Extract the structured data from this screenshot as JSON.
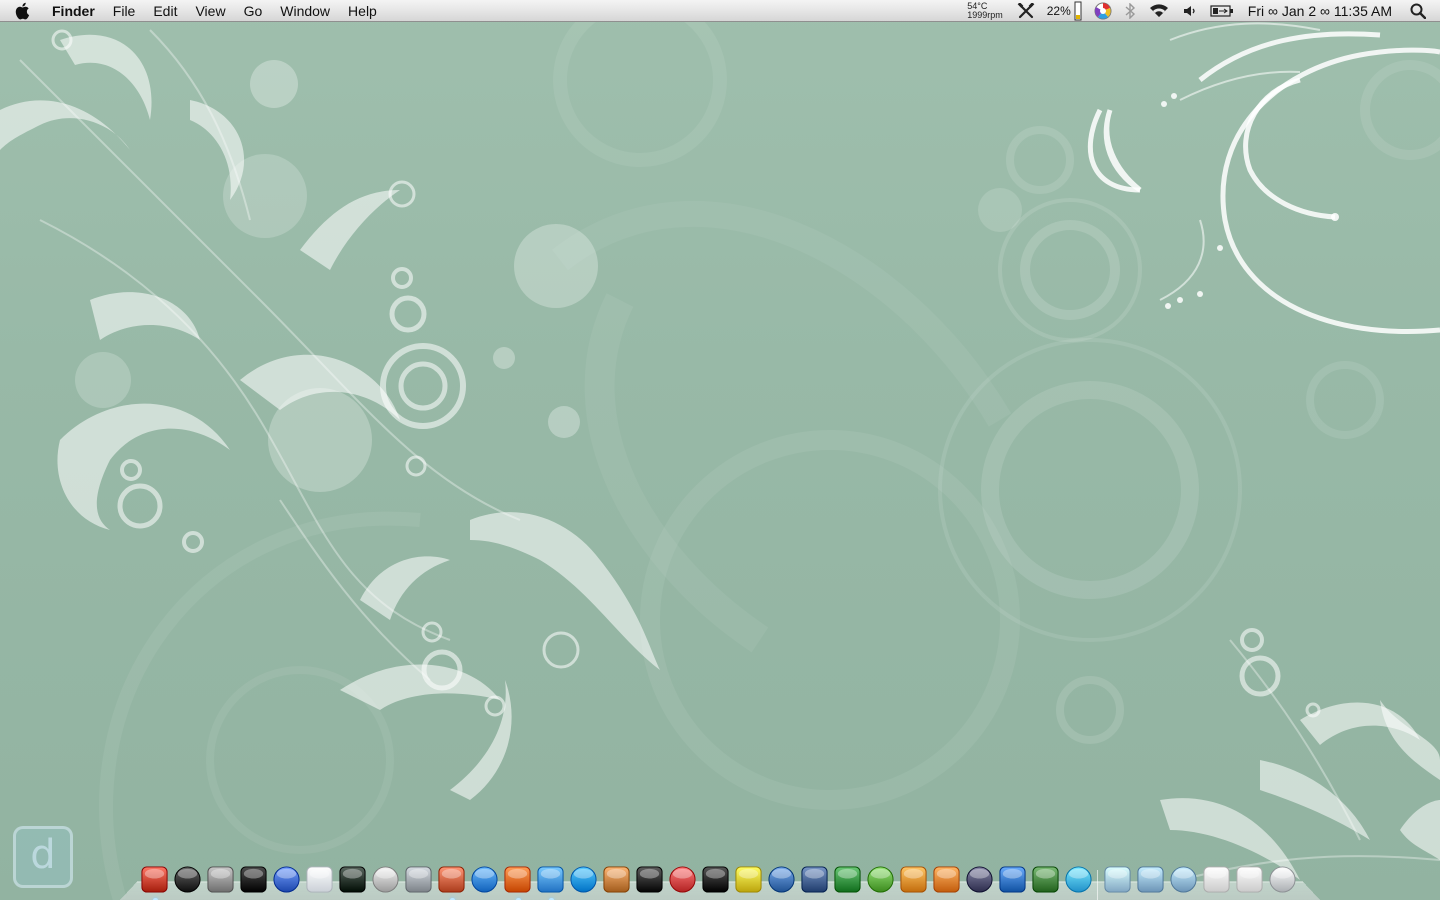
{
  "menubar": {
    "app_name": "Finder",
    "menus": [
      "File",
      "Edit",
      "View",
      "Go",
      "Window",
      "Help"
    ],
    "status": {
      "temperature": "54°C",
      "fan_speed": "1999rpm",
      "battery_percent": "22%",
      "clock": "Fri ∞ Jan 2 ∞ 11:35 AM"
    },
    "icons": [
      "apple-icon",
      "tools-icon",
      "battery-level-icon",
      "color-wheel-icon",
      "bluetooth-icon",
      "wifi-icon",
      "volume-icon",
      "battery-icon",
      "spotlight-icon"
    ]
  },
  "widget": {
    "letter": "d"
  },
  "dock": {
    "apps": [
      {
        "name": "finder-icon",
        "color": "#c23b2a",
        "running": true
      },
      {
        "name": "dashboard-icon",
        "color": "#2b2b2b",
        "running": false
      },
      {
        "name": "system-preferences-icon",
        "color": "#8c8c8c",
        "running": false
      },
      {
        "name": "terminal-icon",
        "color": "#111111",
        "running": false
      },
      {
        "name": "time-machine-icon",
        "color": "#3a64c9",
        "running": false
      },
      {
        "name": "airport-utility-icon",
        "color": "#e8eef5",
        "running": false
      },
      {
        "name": "activity-monitor-icon",
        "color": "#1d2a22",
        "running": false
      },
      {
        "name": "disk-utility-icon",
        "color": "#b8b8b8",
        "running": false
      },
      {
        "name": "script-editor-icon",
        "color": "#9aa0a6",
        "running": false
      },
      {
        "name": "address-book-icon",
        "color": "#c85a3a",
        "running": true
      },
      {
        "name": "safari-icon",
        "color": "#2f7fd8",
        "running": false
      },
      {
        "name": "firefox-icon",
        "color": "#e2621b",
        "running": true
      },
      {
        "name": "itunes-icon",
        "color": "#3f8fe0",
        "running": true
      },
      {
        "name": "quicktime-icon",
        "color": "#1a8fe3",
        "running": false
      },
      {
        "name": "iphoto-icon",
        "color": "#c07a3a",
        "running": false
      },
      {
        "name": "front-row-icon",
        "color": "#222222",
        "running": false
      },
      {
        "name": "textedit-icon",
        "color": "#d04040",
        "running": false
      },
      {
        "name": "ipod-icon",
        "color": "#1b1b1b",
        "running": false
      },
      {
        "name": "scanner-icon",
        "color": "#d9c22a",
        "running": false
      },
      {
        "name": "virtual-machine-icon",
        "color": "#3d6fb0",
        "running": false
      },
      {
        "name": "spaces-icon",
        "color": "#3d5a8a",
        "running": false
      },
      {
        "name": "numbers-icon",
        "color": "#2e8b3a",
        "running": false
      },
      {
        "name": "dreamweaver-icon",
        "color": "#5aa83c",
        "running": false
      },
      {
        "name": "keynote-icon",
        "color": "#e08a2a",
        "running": false
      },
      {
        "name": "pages-icon",
        "color": "#e07a2a",
        "running": false
      },
      {
        "name": "pen-tool-icon",
        "color": "#4a4a6a",
        "running": false
      },
      {
        "name": "word-icon",
        "color": "#2e6fbf",
        "running": false
      },
      {
        "name": "adium-icon",
        "color": "#3f7f3a",
        "running": false
      },
      {
        "name": "network-icon",
        "color": "#3faee6",
        "running": false
      }
    ],
    "stacks": [
      {
        "name": "documents-stack-icon",
        "color": "#9fc4e0",
        "running": false
      },
      {
        "name": "applications-folder-icon",
        "color": "#8ab2d4",
        "running": false
      },
      {
        "name": "downloads-folder-icon",
        "color": "#8ab2d4",
        "running": false
      },
      {
        "name": "mail-stack-icon",
        "color": "#e8e8e8",
        "running": false
      },
      {
        "name": "preview-stack-icon",
        "color": "#e8e8e8",
        "running": false
      },
      {
        "name": "trash-icon",
        "color": "#c8ccd0",
        "running": false
      }
    ]
  }
}
